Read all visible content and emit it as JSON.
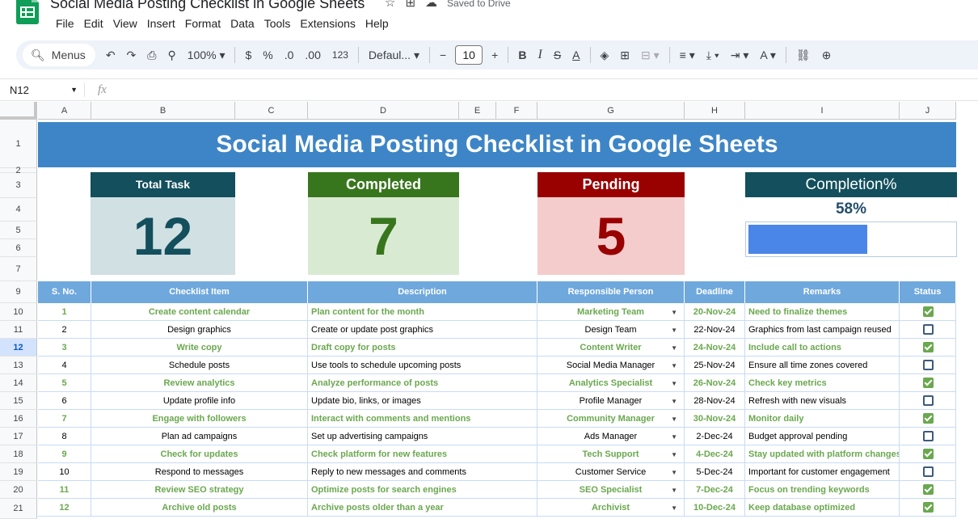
{
  "app": {
    "title": "Social Media Posting Checklist in Google Sheets",
    "saved_status": "Saved to Drive",
    "menu": [
      "File",
      "Edit",
      "View",
      "Insert",
      "Format",
      "Data",
      "Tools",
      "Extensions",
      "Help"
    ]
  },
  "toolbar": {
    "menus_label": "Menus",
    "zoom": "100%",
    "currency": "$",
    "percent": "%",
    "decimal_decrease": ".0",
    "decimal_increase": ".00",
    "number_format": "123",
    "font": "Defaul...",
    "font_size": "10",
    "bold": "B",
    "italic": "I",
    "strike": "S",
    "text_color": "A"
  },
  "formula_bar": {
    "cell_ref": "N12",
    "fx": "fx"
  },
  "columns": [
    "A",
    "B",
    "C",
    "D",
    "E",
    "F",
    "G",
    "H",
    "I",
    "J"
  ],
  "rows": [
    "1",
    "2",
    "3",
    "4",
    "5",
    "6",
    "7",
    "9",
    "10",
    "11",
    "12",
    "13",
    "14",
    "15",
    "16",
    "17",
    "18",
    "19",
    "20",
    "21"
  ],
  "active_row": "12",
  "dashboard": {
    "title": "Social Media Posting Checklist in Google Sheets",
    "total_label": "Total Task",
    "total_value": "12",
    "completed_label": "Completed",
    "completed_value": "7",
    "pending_label": "Pending",
    "pending_value": "5",
    "completion_label": "Completion%",
    "completion_value": "58%",
    "completion_fraction": 0.58
  },
  "colors": {
    "banner": "#3d85c6",
    "total_head": "#134f5c",
    "total_body": "#d0e0e3",
    "completed_head": "#38761d",
    "completed_body": "#d9ead3",
    "pending_head": "#990000",
    "pending_body": "#f4cccc",
    "table_head": "#6fa8dc",
    "done_text": "#6aa84f",
    "progress": "#4a86e8"
  },
  "table": {
    "headers": [
      "S. No.",
      "Checklist Item",
      "Description",
      "Responsible Person",
      "Deadline",
      "Remarks",
      "Status"
    ],
    "rows": [
      {
        "no": "1",
        "item": "Create content calendar",
        "desc": "Plan content for the month",
        "person": "Marketing Team",
        "deadline": "20-Nov-24",
        "remarks": "Need to finalize themes",
        "done": true
      },
      {
        "no": "2",
        "item": "Design graphics",
        "desc": "Create or update post graphics",
        "person": "Design Team",
        "deadline": "22-Nov-24",
        "remarks": "Graphics from last campaign reused",
        "done": false
      },
      {
        "no": "3",
        "item": "Write copy",
        "desc": "Draft copy for posts",
        "person": "Content Writer",
        "deadline": "24-Nov-24",
        "remarks": "Include call to actions",
        "done": true
      },
      {
        "no": "4",
        "item": "Schedule posts",
        "desc": "Use tools to schedule upcoming posts",
        "person": "Social Media Manager",
        "deadline": "25-Nov-24",
        "remarks": "Ensure all time zones covered",
        "done": false
      },
      {
        "no": "5",
        "item": "Review analytics",
        "desc": "Analyze performance of posts",
        "person": "Analytics Specialist",
        "deadline": "26-Nov-24",
        "remarks": "Check key metrics",
        "done": true
      },
      {
        "no": "6",
        "item": "Update profile info",
        "desc": "Update bio, links, or images",
        "person": "Profile Manager",
        "deadline": "28-Nov-24",
        "remarks": "Refresh with new visuals",
        "done": false
      },
      {
        "no": "7",
        "item": "Engage with followers",
        "desc": "Interact with comments and mentions",
        "person": "Community Manager",
        "deadline": "30-Nov-24",
        "remarks": "Monitor daily",
        "done": true
      },
      {
        "no": "8",
        "item": "Plan ad campaigns",
        "desc": "Set up advertising campaigns",
        "person": "Ads Manager",
        "deadline": "2-Dec-24",
        "remarks": "Budget approval pending",
        "done": false
      },
      {
        "no": "9",
        "item": "Check for updates",
        "desc": "Check platform for new features",
        "person": "Tech Support",
        "deadline": "4-Dec-24",
        "remarks": "Stay updated with platform changes",
        "done": true
      },
      {
        "no": "10",
        "item": "Respond to messages",
        "desc": "Reply to new messages and comments",
        "person": "Customer Service",
        "deadline": "5-Dec-24",
        "remarks": "Important for customer engagement",
        "done": false
      },
      {
        "no": "11",
        "item": "Review SEO strategy",
        "desc": "Optimize posts for search engines",
        "person": "SEO Specialist",
        "deadline": "7-Dec-24",
        "remarks": "Focus on trending keywords",
        "done": true
      },
      {
        "no": "12",
        "item": "Archive old posts",
        "desc": "Archive posts older than a year",
        "person": "Archivist",
        "deadline": "10-Dec-24",
        "remarks": "Keep database optimized",
        "done": true
      }
    ]
  }
}
